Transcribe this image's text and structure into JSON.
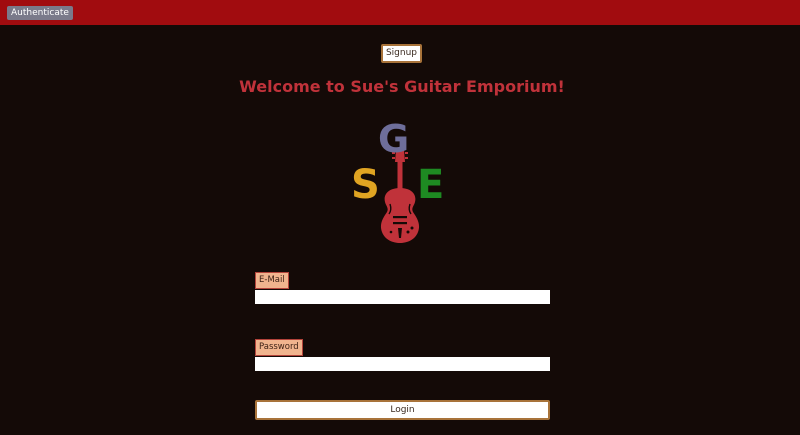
{
  "header": {
    "authenticate_label": "Authenticate",
    "bar_color": "#a10c0f"
  },
  "signup": {
    "label": "Signup"
  },
  "welcome": {
    "title": "Welcome to Sue's Guitar Emporium!",
    "color": "#c0323a"
  },
  "logo": {
    "letters": [
      "G",
      "S",
      "E"
    ],
    "letter_colors": [
      "#6e6e9a",
      "#e0a422",
      "#1e8a22"
    ],
    "guitar_color": "#c0323a",
    "icon": "guitar-icon"
  },
  "form": {
    "email": {
      "label": "E-Mail",
      "value": "",
      "placeholder": ""
    },
    "password": {
      "label": "Password",
      "value": "",
      "placeholder": ""
    },
    "login_label": "Login"
  }
}
